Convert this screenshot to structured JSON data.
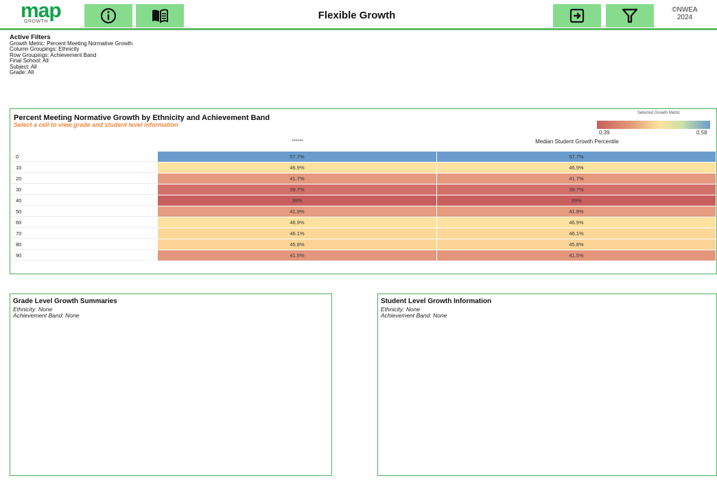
{
  "header": {
    "logo_text": "map",
    "logo_sub": "GROWTH",
    "title": "Flexible Growth",
    "copyright_line1": "©NWEA",
    "copyright_line2": "2024",
    "accent_color": "#86dc8c"
  },
  "icons": {
    "info": "info-icon",
    "guide": "book-icon",
    "export": "export-icon",
    "filter": "filter-icon"
  },
  "filters": {
    "heading": "Active Filters",
    "lines": [
      "Growth Metric: Percent Meeting Normative Growth",
      "Column Groupings: Ethnicity",
      "Row Groupings: Achievement Band",
      "Final School: All",
      "Subject: All",
      "Grade: All"
    ]
  },
  "main_panel": {
    "title": "Percent Meeting Normative Growth by Ethnicity and Achievement Band",
    "subtitle": "Select a cell to view grade and student level information",
    "legend_title": "Selected Growth Metric",
    "legend_min": "0.39",
    "legend_max": "0.58",
    "columns": [
      "******",
      "Median Student Growth Percentile"
    ],
    "rows": [
      {
        "label": "0",
        "values": [
          "57.7%",
          "57.7%"
        ],
        "color": "#6a9ccd"
      },
      {
        "label": "10",
        "values": [
          "46.9%",
          "46.9%"
        ],
        "color": "#fde19e"
      },
      {
        "label": "20",
        "values": [
          "41.7%",
          "41.7%"
        ],
        "color": "#e5997e"
      },
      {
        "label": "30",
        "values": [
          "39.7%",
          "39.7%"
        ],
        "color": "#d3706b"
      },
      {
        "label": "40",
        "values": [
          "39%",
          "39%"
        ],
        "color": "#c95e5e"
      },
      {
        "label": "50",
        "values": [
          "41.9%",
          "41.9%"
        ],
        "color": "#e59c80"
      },
      {
        "label": "60",
        "values": [
          "46.9%",
          "46.9%"
        ],
        "color": "#fde19e"
      },
      {
        "label": "70",
        "values": [
          "46.1%",
          "46.1%"
        ],
        "color": "#fbd798"
      },
      {
        "label": "80",
        "values": [
          "45.8%",
          "45.8%"
        ],
        "color": "#fad496"
      },
      {
        "label": "90",
        "values": [
          "41.5%",
          "41.5%"
        ],
        "color": "#e3967c"
      }
    ]
  },
  "grade_panel": {
    "title": "Grade Level Growth Summaries",
    "ethnicity": "Ethnicity: None",
    "band": "Achievement Band: None"
  },
  "student_panel": {
    "title": "Student Level Growth Information",
    "ethnicity": "Ethnicity: None",
    "band": "Achievement Band: None"
  }
}
